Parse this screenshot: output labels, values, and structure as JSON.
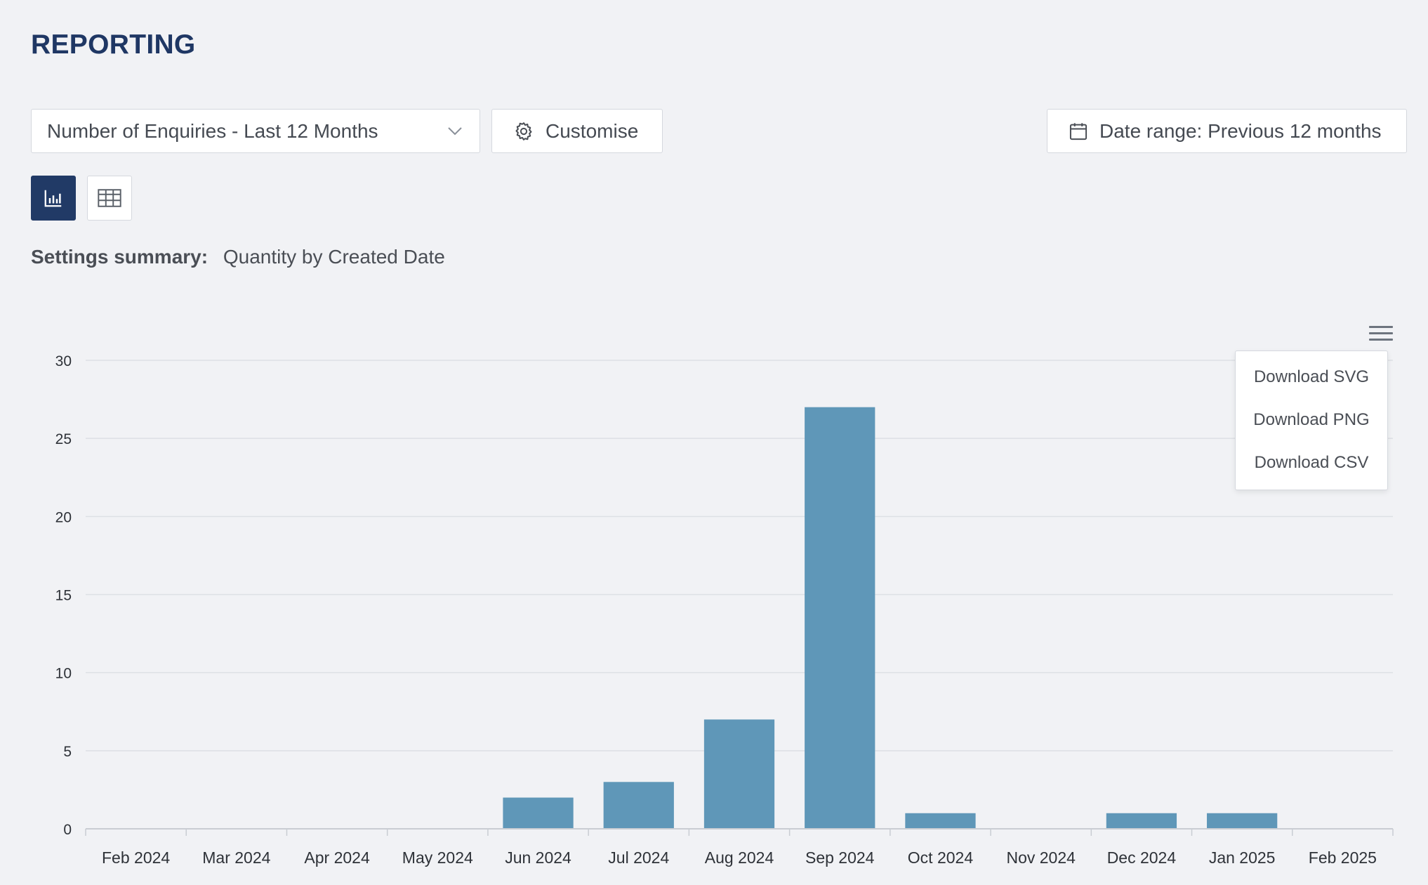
{
  "page": {
    "title": "REPORTING"
  },
  "controls": {
    "report_select": {
      "value": "Number of Enquiries - Last 12 Months",
      "icon": "chevron-down-icon"
    },
    "customise": {
      "label": "Customise",
      "icon": "gear-icon"
    },
    "date_range": {
      "label": "Date range: Previous 12 months",
      "icon": "calendar-icon"
    },
    "view_toggle": {
      "chart_icon": "bar-chart-icon",
      "table_icon": "table-grid-icon",
      "active": "chart"
    }
  },
  "summary": {
    "label": "Settings summary:",
    "value": "Quantity by Created Date"
  },
  "export_menu": {
    "icon": "hamburger-menu-icon",
    "items": [
      "Download SVG",
      "Download PNG",
      "Download CSV"
    ]
  },
  "colors": {
    "title": "#1f3764",
    "active_toggle": "#213a66",
    "bar": "#5f97b8"
  },
  "chart_data": {
    "type": "bar",
    "categories": [
      "Feb 2024",
      "Mar 2024",
      "Apr 2024",
      "May 2024",
      "Jun 2024",
      "Jul 2024",
      "Aug 2024",
      "Sep 2024",
      "Oct 2024",
      "Nov 2024",
      "Dec 2024",
      "Jan 2025",
      "Feb 2025"
    ],
    "values": [
      0,
      0,
      0,
      0,
      2,
      3,
      7,
      27,
      1,
      0,
      1,
      1,
      0
    ],
    "ylim": [
      0,
      30
    ],
    "yticks": [
      0,
      5,
      10,
      15,
      20,
      25,
      30
    ],
    "grid": true,
    "title": "",
    "xlabel": "",
    "ylabel": ""
  }
}
